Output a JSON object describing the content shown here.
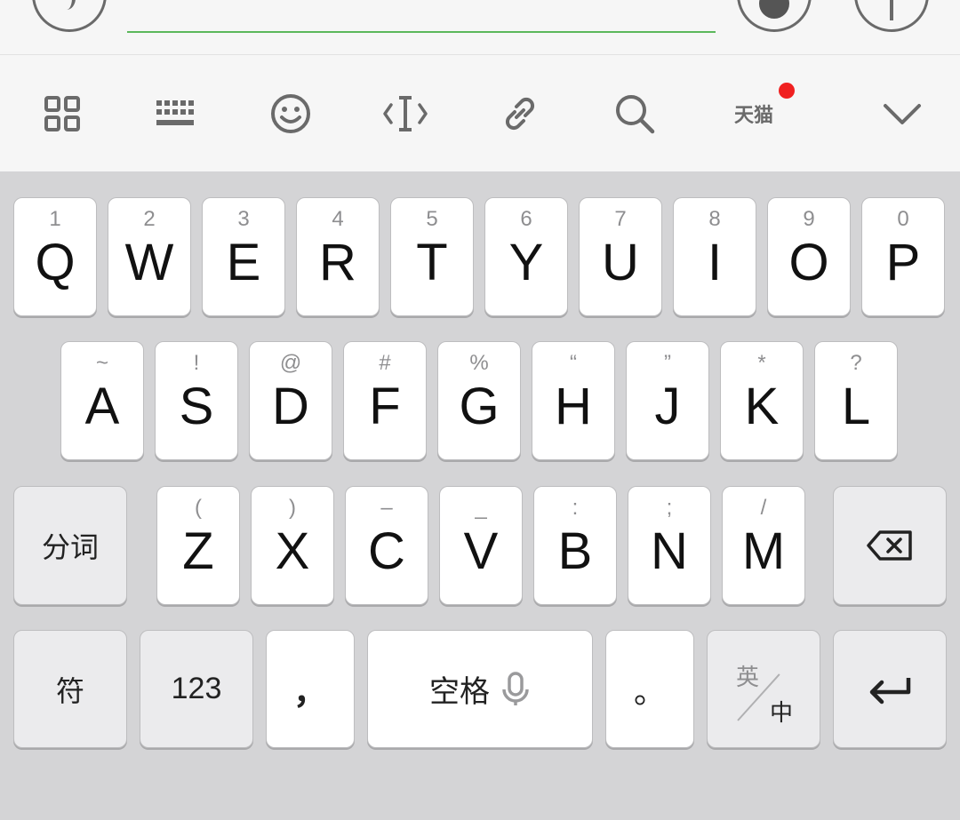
{
  "colors": {
    "accent_underline": "#5cb85c",
    "notification_dot": "#f02020",
    "keyboard_bg": "#d4d4d6",
    "toolbar_bg": "#f6f6f6",
    "key_bg": "#ffffff",
    "func_key_bg": "#ebebed"
  },
  "top_bar": {
    "icons": [
      "voice-icon",
      "emoji-icon",
      "plus-icon"
    ]
  },
  "toolbar": {
    "items": [
      {
        "icon": "grid-menu-icon"
      },
      {
        "icon": "keyboard-switch-icon"
      },
      {
        "icon": "smiley-icon"
      },
      {
        "icon": "text-cursor-icon"
      },
      {
        "icon": "link-icon"
      },
      {
        "icon": "search-icon"
      },
      {
        "icon": "tmall-icon",
        "label": "天猫"
      },
      {
        "icon": "chevron-down-icon"
      }
    ]
  },
  "keyboard": {
    "row1": [
      {
        "main": "Q",
        "hint": "1"
      },
      {
        "main": "W",
        "hint": "2"
      },
      {
        "main": "E",
        "hint": "3"
      },
      {
        "main": "R",
        "hint": "4"
      },
      {
        "main": "T",
        "hint": "5"
      },
      {
        "main": "Y",
        "hint": "6"
      },
      {
        "main": "U",
        "hint": "7"
      },
      {
        "main": "I",
        "hint": "8"
      },
      {
        "main": "O",
        "hint": "9"
      },
      {
        "main": "P",
        "hint": "0"
      }
    ],
    "row2": [
      {
        "main": "A",
        "hint": "~"
      },
      {
        "main": "S",
        "hint": "!"
      },
      {
        "main": "D",
        "hint": "@"
      },
      {
        "main": "F",
        "hint": "#"
      },
      {
        "main": "G",
        "hint": "%"
      },
      {
        "main": "H",
        "hint": "“"
      },
      {
        "main": "J",
        "hint": "”"
      },
      {
        "main": "K",
        "hint": "*"
      },
      {
        "main": "L",
        "hint": "?"
      }
    ],
    "row3": [
      {
        "main": "Z",
        "hint": "("
      },
      {
        "main": "X",
        "hint": ")"
      },
      {
        "main": "C",
        "hint": "–"
      },
      {
        "main": "V",
        "hint": "_"
      },
      {
        "main": "B",
        "hint": ":"
      },
      {
        "main": "N",
        "hint": ";"
      },
      {
        "main": "M",
        "hint": "/"
      }
    ],
    "segment_label": "分词",
    "symbol_label": "符",
    "number_label": "123",
    "comma_label": "，",
    "space_label": "空格",
    "period_label": "。",
    "lang_en_label": "英",
    "lang_zh_label": "中"
  }
}
